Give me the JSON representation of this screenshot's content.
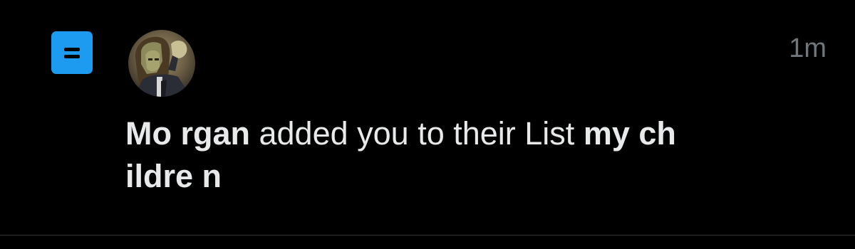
{
  "notification": {
    "icon": "list-icon",
    "icon_color": "#1d9bf0",
    "timestamp": "1m",
    "user_name": "Mo rgan",
    "action_text": " added you to their List ",
    "list_name_line1": "my ch",
    "list_name_line2": "ildre n"
  },
  "colors": {
    "background": "#000000",
    "text_primary": "#e7e9ea",
    "text_secondary": "#71767b",
    "divider": "#2f3336"
  }
}
